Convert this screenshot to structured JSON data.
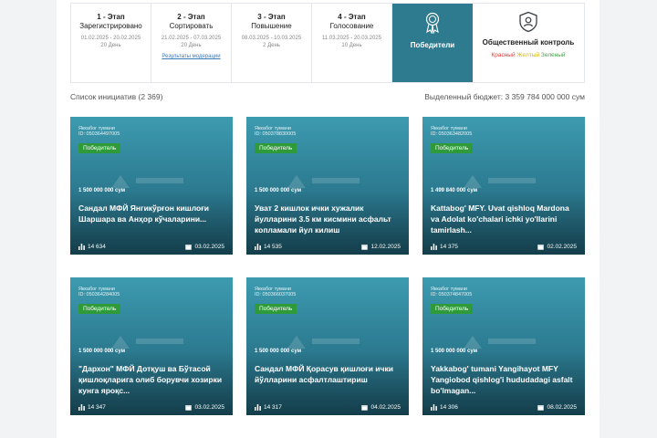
{
  "stages": [
    {
      "title": "1 - Этап",
      "sub": "Зарегистрировано",
      "dates": "01.02.2025 - 20.02.2025",
      "days": "20 День",
      "link": ""
    },
    {
      "title": "2 - Этап",
      "sub": "Сортировать",
      "dates": "21.02.2025 - 07.03.2025",
      "days": "20 День",
      "link": "Результаты модерации"
    },
    {
      "title": "3 - Этап",
      "sub": "Повышение",
      "dates": "08.03.2025 - 10.03.2025",
      "days": "2 День",
      "link": ""
    },
    {
      "title": "4 - Этап",
      "sub": "Голосование",
      "dates": "11.03.2025 - 20.03.2025",
      "days": "10 День",
      "link": ""
    }
  ],
  "winners_label": "Победители",
  "control": {
    "label": "Общественный контроль",
    "legend_red": "Красный",
    "legend_yellow": "Жeлтый",
    "legend_green": "Зеленый"
  },
  "list": {
    "count_label": "Список инициатив (2 369)",
    "budget_label": "Выделенный бюджет: 3 359 784 000 000 сум"
  },
  "cards": [
    {
      "district": "Яккабог тумани",
      "id": "ID: 050364497005",
      "badge": "Победитель",
      "budget": "1 500 000 000 сум",
      "title": "Сандал МФЙ Янгикўрғон кишлоғи Шаршара ва Анҳор кўчаларини...",
      "votes": "14 634",
      "date": "03.02.2025"
    },
    {
      "district": "Яккабог тумани",
      "id": "ID: 050378830005",
      "badge": "Победитель",
      "budget": "1 500 000 000 сум",
      "title": "Уват 2 кишлок ички хужалик йулларини 3.5 км кисмини асфальт копламали йул килиш",
      "votes": "14 535",
      "date": "12.02.2025"
    },
    {
      "district": "Яккабог тумани",
      "id": "ID: 050363482005",
      "badge": "Победитель",
      "budget": "1 499 840 000 сум",
      "title": "Kattabog' MFY. Uvat qishloq Mardona va Adolat ko'chalari ichki yo'llarini tamirlash...",
      "votes": "14 375",
      "date": "02.02.2025"
    },
    {
      "district": "Яккабог тумани",
      "id": "ID: 050364284005",
      "badge": "Победитель",
      "budget": "1 500 000 000 сум",
      "title": "\"Дархон\" МФЙ Дотқуш ва Бўтасой қишлоқларига олиб борувчи хозирки кунга яроқс...",
      "votes": "14 347",
      "date": "03.02.2025"
    },
    {
      "district": "Яккабог тумани",
      "id": "ID: 050366037005",
      "badge": "Победитель",
      "budget": "1 500 000 000 сум",
      "title": "Сандал МФЙ Қорасув қишлоғи ички йўлларини асфалтлаштириш",
      "votes": "14 317",
      "date": "04.02.2025"
    },
    {
      "district": "Яккабог тумани",
      "id": "ID: 050374847005",
      "badge": "Победитель",
      "budget": "1 500 000 000 сум",
      "title": "Yakkabog' tumani Yangihayot MFY Yangiobod qishlog'i hududadagi asfalt bo'lmagan...",
      "votes": "14 306",
      "date": "08.02.2025"
    }
  ],
  "icons": {
    "medal": "medal-icon",
    "shield": "shield-user-icon",
    "votes": "votes-icon",
    "calendar": "calendar-icon"
  },
  "colors": {
    "accent": "#2e7b90",
    "badge": "#2e9a3a",
    "link": "#3a7bbd"
  }
}
